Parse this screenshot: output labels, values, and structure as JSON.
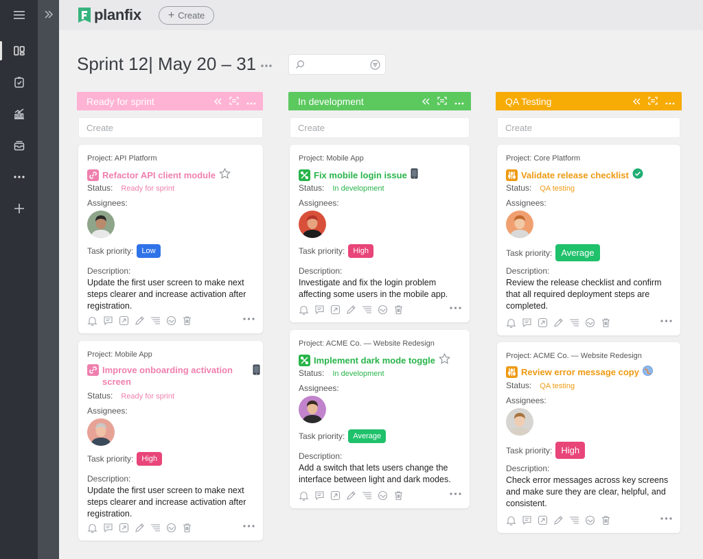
{
  "app": {
    "logo_text": "planfix",
    "create_label": "Create"
  },
  "page": {
    "title": "Sprint 12| May 20 – 31"
  },
  "columns": [
    {
      "label": "Ready for sprint",
      "create_placeholder": "Create",
      "color": "#ffb3d4"
    },
    {
      "label": "In development",
      "create_placeholder": "Create",
      "color": "#5cc95f"
    },
    {
      "label": "QA Testing",
      "create_placeholder": "Create",
      "color": "#f7ab05"
    }
  ],
  "labels": {
    "status": "Status:",
    "assignees": "Assignees:",
    "priority": "Task priority:",
    "description": "Description:"
  },
  "cards": [
    {
      "project": "Project: API Platform",
      "title": "Refactor API client module",
      "status": "Ready for sprint",
      "priority": "Low",
      "description": "Update the first user screen to make next steps clearer and increase activation after registration.",
      "title_color": "#ef7fae",
      "priority_color": "#2f73e8",
      "extra_icon": "star-icon"
    },
    {
      "project": "Project: Mobile App",
      "title": "Improve onboarding activation screen",
      "status": "Ready for sprint",
      "priority": "High",
      "description": "Update the first user screen to make next steps clearer and increase activation after registration.",
      "title_color": "#ef7fae",
      "priority_color": "#e84579",
      "extra_icon": "mobile-phone-icon"
    },
    {
      "project": "Project: Mobile App",
      "title": "Fix mobile login issue",
      "status": "In development",
      "priority": "High",
      "description": "Investigate and fix the login problem affecting some users in the mobile app.",
      "title_color": "#28b44a",
      "priority_color": "#e84579",
      "extra_icon": "mobile-phone-icon"
    },
    {
      "project": "Project: ACME Co. — Website Redesign",
      "title": "Implement dark mode toggle",
      "status": "In development",
      "priority": "Average",
      "description": "Add a switch that lets users change the interface between light and dark modes.",
      "title_color": "#28b44a",
      "priority_color": "#1fc16b",
      "extra_icon": "star-icon"
    },
    {
      "project": "Project: Core Platform",
      "title": "Validate release checklist",
      "status": "QA testing",
      "priority": "Average",
      "description": "Review the release checklist and confirm that all required deployment steps are completed.",
      "title_color": "#ee9a12",
      "priority_color": "#1fc16b",
      "extra_icon": "check-circle-icon"
    },
    {
      "project": "Project: ACME Co. — Website Redesign",
      "title": "Review error message copy",
      "status": "QA testing",
      "priority": "High",
      "description": "Check error messages across key screens and make sure they are clear, helpful, and consistent.",
      "title_color": "#ee9a12",
      "priority_color": "#e84579",
      "extra_icon": "globe-icon"
    }
  ]
}
